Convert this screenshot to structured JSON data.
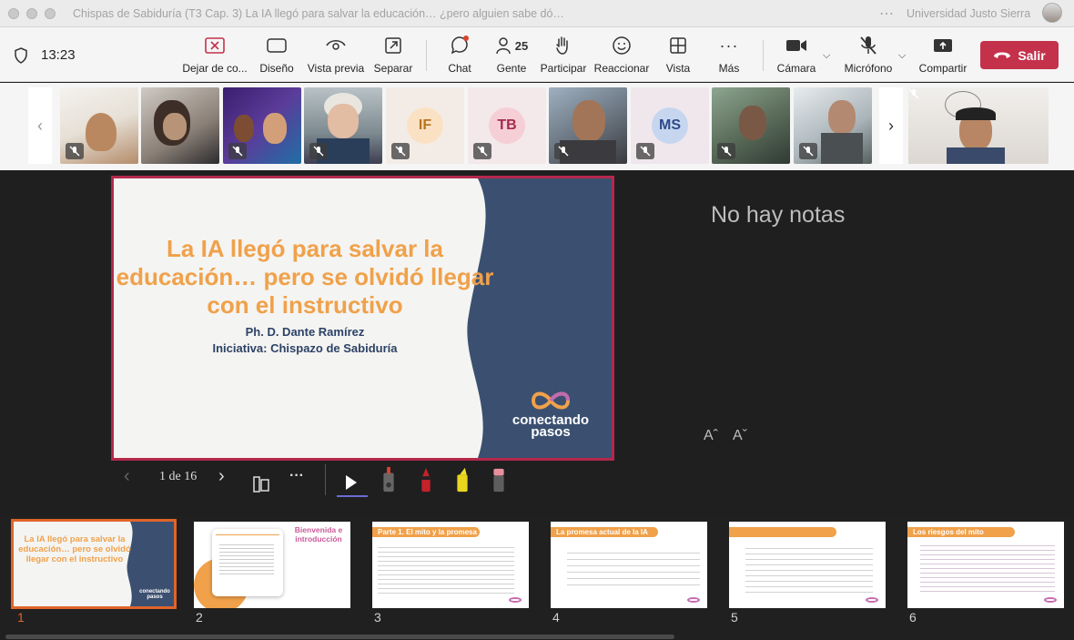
{
  "window": {
    "title": "Chispas de Sabiduría (T3 Cap. 3) La IA llegó para salvar la educación… ¿pero alguien sabe dó…",
    "org": "Universidad Justo Sierra"
  },
  "toolbar": {
    "time": "13:23",
    "stop_label": "Dejar de co...",
    "design_label": "Diseño",
    "preview_label": "Vista previa",
    "separate_label": "Separar",
    "chat_label": "Chat",
    "people_label": "Gente",
    "people_count": "25",
    "participate_label": "Participar",
    "react_label": "Reaccionar",
    "view_label": "Vista",
    "more_label": "Más",
    "camera_label": "Cámara",
    "mic_label": "Micrófono",
    "share_label": "Compartir",
    "leave_label": "Salir"
  },
  "participants": [
    {
      "type": "video",
      "muted": true
    },
    {
      "type": "video",
      "muted": false
    },
    {
      "type": "video",
      "muted": true
    },
    {
      "type": "video",
      "muted": true
    },
    {
      "type": "initials",
      "initials": "IF",
      "muted": true
    },
    {
      "type": "initials",
      "initials": "TB",
      "muted": true
    },
    {
      "type": "video",
      "muted": true
    },
    {
      "type": "initials",
      "initials": "MS",
      "muted": true
    },
    {
      "type": "video",
      "muted": true
    },
    {
      "type": "video",
      "muted": true
    },
    {
      "type": "video",
      "muted": true
    }
  ],
  "slide": {
    "title": "La IA llegó para salvar la educación… pero se olvidó llegar con el instructivo",
    "author": "Ph. D. Dante Ramírez",
    "initiative": "Iniciativa: Chispazo de Sabiduría",
    "logo": "conectando pasos"
  },
  "notes": {
    "empty_text": "No hay notas",
    "font_up": "Aˆ",
    "font_down": "Aˇ"
  },
  "presenter": {
    "page_counter": "1 de 16"
  },
  "thumbnails": [
    {
      "num": "1",
      "title": "La IA llegó para salvar la educación… pero se olvidó llegar con el instructivo",
      "selected": true
    },
    {
      "num": "2",
      "title": "Bienvenida e introducción",
      "selected": false
    },
    {
      "num": "3",
      "title": "Parte 1. El mito y la promesa",
      "selected": false
    },
    {
      "num": "4",
      "title": "La promesa actual de la IA",
      "selected": false
    },
    {
      "num": "5",
      "title": "",
      "selected": false
    },
    {
      "num": "6",
      "title": "Los riesgos del mito",
      "selected": false
    }
  ],
  "colors": {
    "accent_red": "#c4314b",
    "slide_orange": "#f0a14a",
    "slide_navy": "#2d4266",
    "selected_thumb": "#e0642a"
  }
}
